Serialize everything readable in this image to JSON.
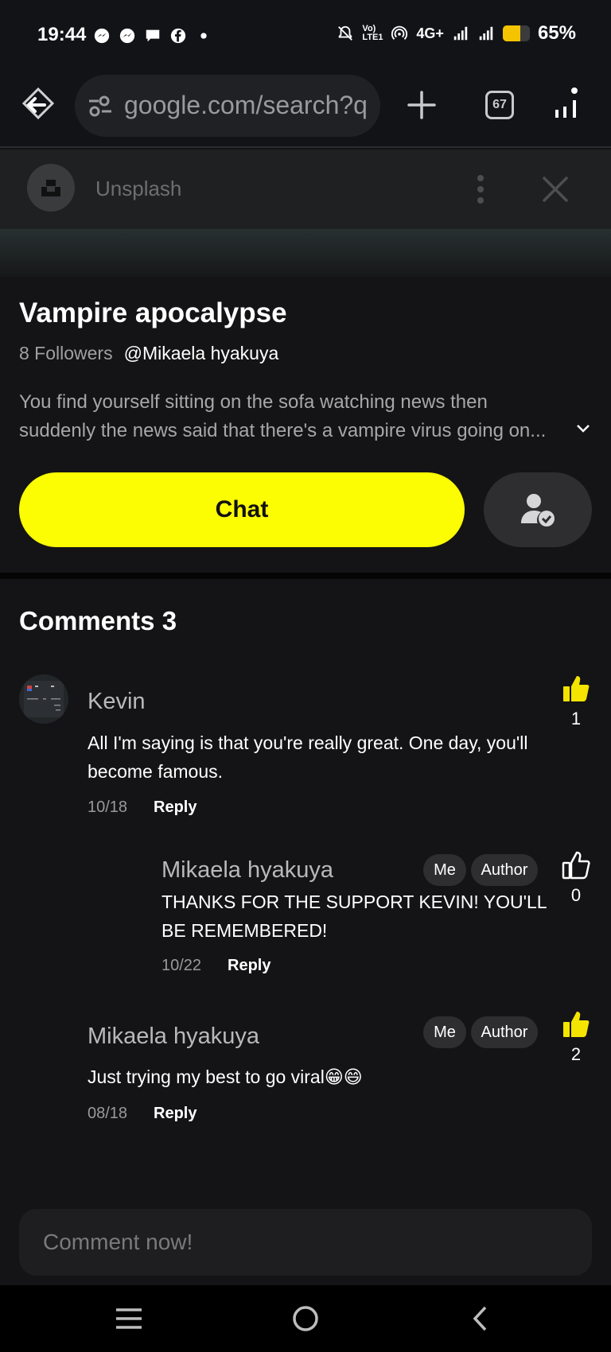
{
  "status_bar": {
    "time": "19:44",
    "notification_icons": [
      "messenger-icon",
      "messenger-icon",
      "chat-icon",
      "facebook-icon",
      "dot-icon"
    ],
    "right_icons": [
      "mute-bell-icon",
      "volte-icon",
      "hotspot-icon",
      "signal-icon",
      "signal-icon",
      "battery-icon"
    ],
    "volte_label": "Vo) LTE1",
    "network": "4G+",
    "battery_level": 0.65,
    "battery_percent": "65%"
  },
  "browser": {
    "url": "google.com/search?q",
    "tab_count": "67",
    "icons": [
      "home-icon",
      "tune-icon",
      "plus-icon",
      "tabs-icon",
      "menu-icon"
    ]
  },
  "overlay": {
    "app_name": "Unsplash",
    "icons": [
      "unsplash-logo-icon",
      "more-vert-icon",
      "close-icon"
    ]
  },
  "character": {
    "title": "Vampire apocalypse",
    "followers": "8 Followers",
    "author_handle": "@Mikaela hyakuya",
    "description_line1": "You find yourself sitting on the sofa watching news then",
    "description_line2": "suddenly the news said that there's a vampire virus going on...",
    "chat_label": "Chat"
  },
  "comments": {
    "heading": "Comments 3",
    "items": [
      {
        "author": "Kevin",
        "text": "All I'm saying is that you're really great. One day, you'll become famous.",
        "date": "10/18",
        "reply_label": "Reply",
        "likes": "1",
        "liked": true
      },
      {
        "author": "Mikaela hyakuya",
        "tags": [
          "Me",
          "Author"
        ],
        "text": "THANKS FOR THE SUPPORT KEVIN! YOU'LL BE REMEMBERED!",
        "date": "10/22",
        "reply_label": "Reply",
        "likes": "0",
        "liked": false
      },
      {
        "author": "Mikaela hyakuya",
        "tags": [
          "Me",
          "Author"
        ],
        "text": "Just trying my best to go viral😁😄",
        "date": "08/18",
        "reply_label": "Reply",
        "likes": "2",
        "liked": true
      }
    ],
    "input_placeholder": "Comment now!"
  },
  "nav_bar": {
    "icons": [
      "recents-icon",
      "home-circle-icon",
      "back-icon"
    ]
  },
  "colors": {
    "accent_yellow": "#fcfc03",
    "like_yellow": "#f4e400",
    "background": "#141416"
  }
}
